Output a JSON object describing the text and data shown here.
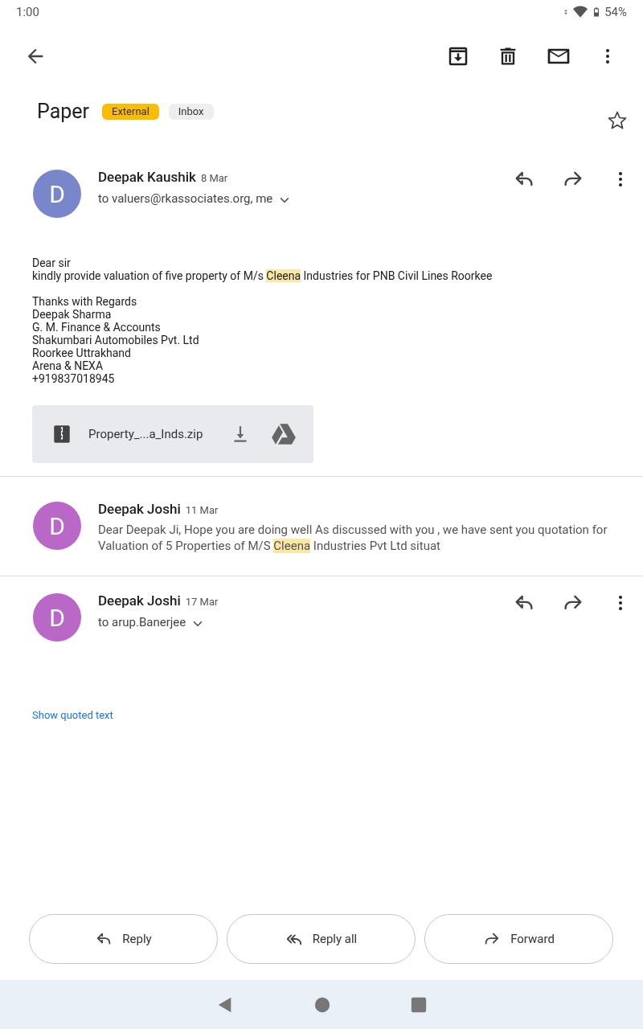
{
  "status_bar": {
    "time": "1:00",
    "battery": "54%"
  },
  "subject": {
    "title": "Paper",
    "labels": [
      {
        "text": "External",
        "color": "#fbbc04"
      },
      {
        "text": "Inbox",
        "color": "#eeeeee"
      }
    ],
    "starred": false
  },
  "messages": [
    {
      "kind": "expanded",
      "sender": "Deepak Kaushik",
      "date": "8 Mar",
      "avatar": "D",
      "color": "#7986cb",
      "recipients": "to valuers@rkassociates.org, me",
      "body": [
        [
          [
            {
              "text": "Dear sir",
              "highlight": false
            }
          ],
          [
            {
              "text": "kindly provide valuation of five property of M/s ",
              "highlight": false
            },
            {
              "text": "Cleena",
              "highlight": true
            },
            {
              "text": " Industries for PNB Civil Lines Roorkee",
              "highlight": false
            }
          ]
        ],
        [
          [
            {
              "text": "Thanks with Regards",
              "highlight": false
            }
          ],
          [
            {
              "text": "Deepak Sharma",
              "highlight": false
            }
          ],
          [
            {
              "text": "G. M. Finance & Accounts",
              "highlight": false
            }
          ],
          [
            {
              "text": "Shakumbari Automobiles Pvt. Ltd",
              "highlight": false
            }
          ],
          [
            {
              "text": "Roorkee Uttrakhand",
              "highlight": false
            }
          ],
          [
            {
              "text": "Arena & NEXA",
              "highlight": false
            }
          ],
          [
            {
              "text": "+919837018945",
              "highlight": false
            }
          ]
        ]
      ],
      "attachment": {
        "name": "Property_...a_Inds.zip"
      }
    },
    {
      "kind": "collapsed",
      "sender": "Deepak Joshi",
      "date": "11 Mar",
      "avatar": "D",
      "color": "#ba68c8",
      "snippet": [
        {
          "text": "Dear Deepak Ji, Hope you are doing well As discussed with you , we have sent you quotation for Valuation of 5 Properties of M/S ",
          "highlight": false
        },
        {
          "text": "Cleena",
          "highlight": true
        },
        {
          "text": " Industries Pvt Ltd situat",
          "highlight": false
        }
      ]
    },
    {
      "kind": "expanded",
      "sender": "Deepak Joshi",
      "date": "17 Mar",
      "avatar": "D",
      "color": "#ba68c8",
      "recipients": "to arup.Banerjee",
      "show_quoted": "Show quoted text"
    }
  ],
  "actions": [
    {
      "kind": "reply",
      "label": "Reply"
    },
    {
      "kind": "reply_all",
      "label": "Reply all"
    },
    {
      "kind": "forward",
      "label": "Forward"
    }
  ]
}
